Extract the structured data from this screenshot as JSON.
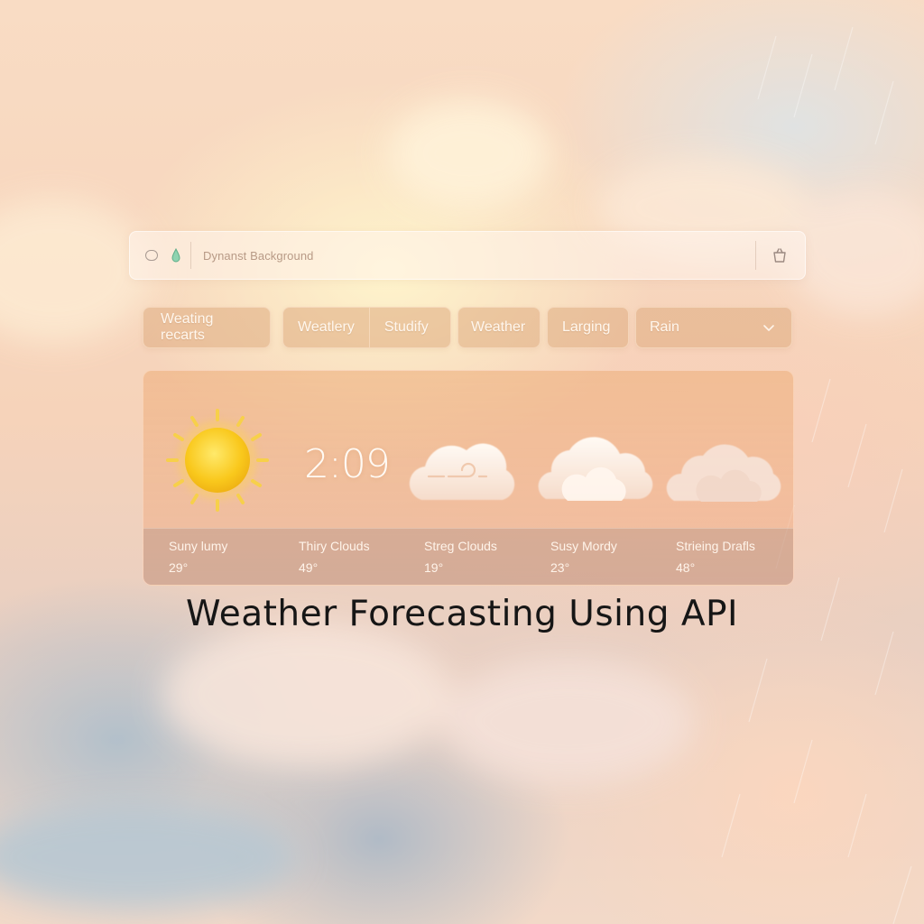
{
  "search": {
    "placeholder": "Dynanst Background"
  },
  "filters": {
    "pill_1": "Weating recarts",
    "pill_2a": "Weatlery",
    "pill_2b": "Studify",
    "pill_3": "Weather",
    "pill_4": "Larging",
    "dropdown": "Rain"
  },
  "card": {
    "time": "2:09",
    "forecasts": [
      {
        "label": "Suny lumy",
        "temp": "29°",
        "icon": "sun-icon"
      },
      {
        "label": "Thiry Clouds",
        "temp": "49°",
        "icon": "cloud-icon"
      },
      {
        "label": "Streg Clouds",
        "temp": "19°",
        "icon": "cloud-wind-icon"
      },
      {
        "label": "Susy Mordy",
        "temp": "23°",
        "icon": "cloud-icon"
      },
      {
        "label": "Strieing Drafls",
        "temp": "48°",
        "icon": "cloud-icon"
      }
    ]
  },
  "title": "Weather Forecasting Using API",
  "colors": {
    "sun": "#f7c51c",
    "pill_bg": "#deac80",
    "title": "#161616"
  }
}
